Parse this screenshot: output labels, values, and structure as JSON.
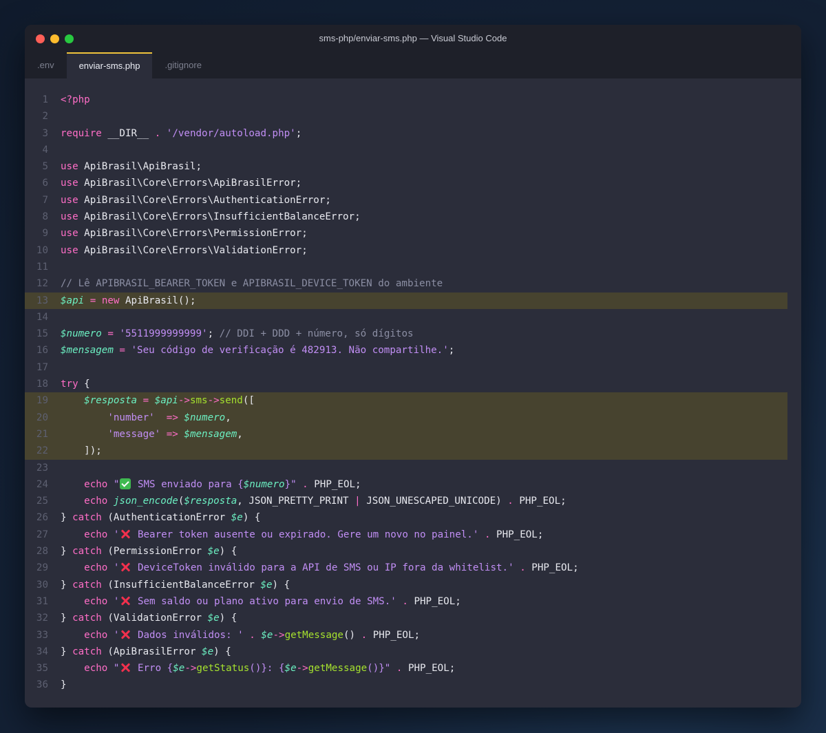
{
  "window": {
    "title": "sms-php/enviar-sms.php — Visual Studio Code",
    "colors": {
      "accent": "#f0c33c",
      "close": "#ff5f57",
      "minimize": "#febc2e",
      "maximize": "#28c840"
    }
  },
  "tabs": [
    {
      "label": ".env",
      "active": false
    },
    {
      "label": "enviar-sms.php",
      "active": true
    },
    {
      "label": ".gitignore",
      "active": false
    }
  ],
  "editor": {
    "highlighted_lines": [
      13,
      19,
      20,
      21,
      22
    ],
    "line_numbers": [
      "1",
      "2",
      "3",
      "4",
      "5",
      "6",
      "7",
      "8",
      "9",
      "10",
      "11",
      "12",
      "13",
      "14",
      "15",
      "16",
      "17",
      "18",
      "19",
      "20",
      "21",
      "22",
      "23",
      "24",
      "25",
      "26",
      "27",
      "28",
      "29",
      "30",
      "31",
      "32",
      "33",
      "34",
      "35",
      "36"
    ],
    "t": {
      "php_open": "<?php",
      "require": "require",
      "dir": "__DIR__",
      "dot": ".",
      "autoload": "'/vendor/autoload.php'",
      "semi": ";",
      "use": "use",
      "ns1": "ApiBrasil\\ApiBrasil",
      "ns2": "ApiBrasil\\Core\\Errors\\ApiBrasilError",
      "ns3": "ApiBrasil\\Core\\Errors\\AuthenticationError",
      "ns4": "ApiBrasil\\Core\\Errors\\InsufficientBalanceError",
      "ns5": "ApiBrasil\\Core\\Errors\\PermissionError",
      "ns6": "ApiBrasil\\Core\\Errors\\ValidationError",
      "comment12": "// Lê APIBRASIL_BEARER_TOKEN e APIBRASIL_DEVICE_TOKEN do ambiente",
      "api": "$api",
      "eq": "=",
      "new": "new",
      "apibrasil_ctor": "ApiBrasil();",
      "numero": "$numero",
      "numero_val": "'5511999999999'",
      "comment15": "// DDI + DDD + número, só dígitos",
      "mensagem": "$mensagem",
      "mensagem_val": "'Seu código de verificação é 482913. Não compartilhe.'",
      "try": "try",
      "brace_open": "{",
      "resposta": "$resposta",
      "arrow": "->",
      "sms": "sms",
      "send": "send",
      "paren_bracket": "([",
      "key_number": "'number'",
      "key_message": "'message'",
      "fat_arrow": "=>",
      "comma": ",",
      "close_arr": "]);",
      "echo": "echo",
      "dq": "\"",
      "sms_enviado": " SMS enviado para {",
      "close_curly": "}",
      "php_eol": "PHP_EOL;",
      "json_encode": "json_encode",
      "lparen": "(",
      "pretty": "JSON_PRETTY_PRINT",
      "pipe": "|",
      "unescaped": "JSON_UNESCAPED_UNICODE)",
      "close_brace": "}",
      "catch": "catch",
      "auth_err": "(AuthenticationError",
      "e": "$e",
      "rparen_brace": ") {",
      "sq": "'",
      "msg27": " Bearer token ausente ou expirado. Gere um novo no painel.'",
      "perm_err": "(PermissionError",
      "msg29": " DeviceToken inválido para a API de SMS ou IP fora da whitelist.'",
      "insuf_err": "(InsufficientBalanceError",
      "msg31": " Sem saldo ou plano ativo para envio de SMS.'",
      "valid_err": "(ValidationError",
      "msg33": " Dados inválidos: '",
      "get_message": "getMessage",
      "parens": "()",
      "apibrasil_err": "(ApiBrasilError",
      "erro": " Erro {",
      "get_status": "getStatus",
      "colon_curly": "()}: {",
      "curly_quote": "()}\""
    }
  }
}
